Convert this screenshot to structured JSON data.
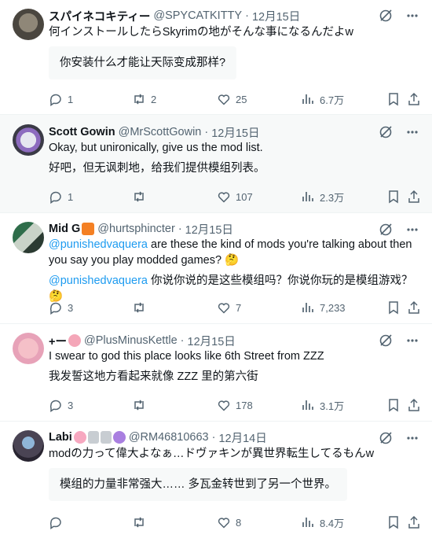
{
  "tweets": [
    {
      "name": "スパイネコキティー",
      "handle": "@SPYCATKITTY",
      "date": "12月15日",
      "text": "何インストールしたらSkyrimの地がそんな事になるんだよw",
      "translation": "你安装什么才能让天际变成那样?",
      "replies": "1",
      "retweets": "2",
      "likes": "25",
      "views": "6.7万"
    },
    {
      "name": "Scott Gowin",
      "handle": "@MrScottGowin",
      "date": "12月15日",
      "text": "Okay, but unironically, give us the mod list.",
      "translation": "好吧，但无讽刺地，给我们提供模组列表。",
      "replies": "1",
      "retweets": "",
      "likes": "107",
      "views": "2.3万"
    },
    {
      "name": "Mid G",
      "handle": "@hurtsphincter",
      "date": "12月15日",
      "mention": "@punishedvaquera",
      "text": " are these the kind of mods you're talking about then you say you play modded games? 🤔",
      "translation": " 你说你说的是这些模组吗？你说你玩的是模组游戏？ 🤔",
      "replies": "3",
      "retweets": "",
      "likes": "7",
      "views": "7,233"
    },
    {
      "name": "+ー",
      "handle": "@PlusMinusKettle",
      "date": "12月15日",
      "text": "I swear to god this place looks like 6th Street from ZZZ",
      "translation": "我发誓这地方看起来就像 ZZZ 里的第六街",
      "replies": "3",
      "retweets": "",
      "likes": "178",
      "views": "3.1万"
    },
    {
      "name": "Labi",
      "handle": "@RM46810663",
      "date": "12月14日",
      "text": "modの力って偉大よなぁ…ドヴァキンが異世界転生してるもんw",
      "translation": "模组的力量非常强大…… 多瓦金转世到了另一个世界。",
      "replies": "",
      "retweets": "",
      "likes": "8",
      "views": "8.4万"
    }
  ],
  "separator": "·",
  "colors": {
    "text": "#0f1419",
    "muted": "#536471",
    "link": "#1d9bf0",
    "alt_bg": "#f7f9f9",
    "border": "#eff3f4"
  },
  "icons": [
    "grok-icon",
    "more-icon",
    "reply-icon",
    "retweet-icon",
    "like-icon",
    "views-icon",
    "bookmark-icon",
    "share-icon"
  ]
}
